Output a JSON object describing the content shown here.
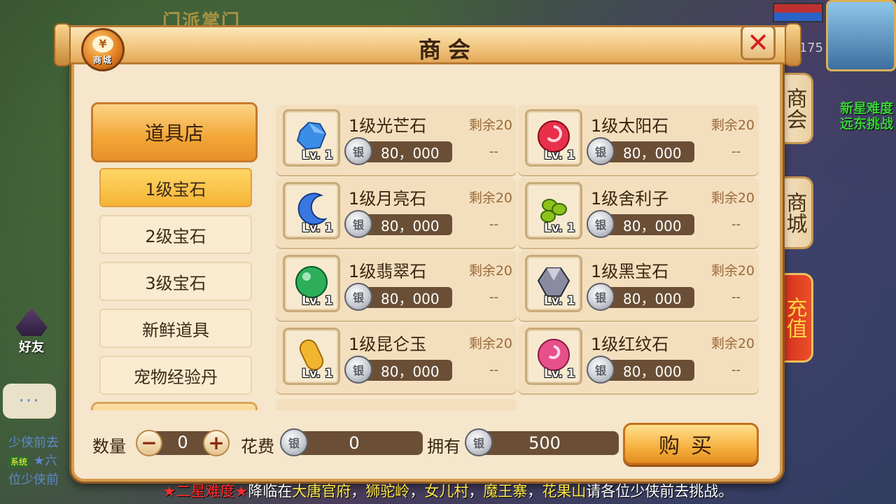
{
  "background": {
    "faded_title": "门派掌门",
    "level": "175",
    "right_notice_lines": [
      "新星难度",
      "远东挑战"
    ],
    "friend_label": "好友",
    "chat_button": "···",
    "chat_lines": [
      {
        "text": "少侠前去"
      },
      {
        "tag": "系统",
        "text": "★六"
      },
      {
        "text": "位少侠前"
      }
    ]
  },
  "window": {
    "title": "商会",
    "shop_icon_symbol": "¥",
    "shop_icon_label": "商城",
    "close_symbol": "✕"
  },
  "side_tabs": [
    {
      "label": "商会"
    },
    {
      "label": "商城"
    },
    {
      "label": "充值"
    }
  ],
  "categories": {
    "main": "道具店",
    "items": [
      {
        "label": "1级宝石",
        "active": true
      },
      {
        "label": "2级宝石",
        "active": false
      },
      {
        "label": "3级宝石",
        "active": false
      },
      {
        "label": "新鲜道具",
        "active": false
      },
      {
        "label": "宠物经验丹",
        "active": false
      }
    ]
  },
  "goods": [
    {
      "name": "1级光芒石",
      "remain": "剩余20",
      "price": "80，000",
      "dash": "--",
      "level": "Lv. 1",
      "gem": "blue-crystal",
      "color": "#3b8ee8"
    },
    {
      "name": "1级太阳石",
      "remain": "剩余20",
      "price": "80，000",
      "dash": "--",
      "level": "Lv. 1",
      "gem": "red-orb",
      "color": "#e8304a"
    },
    {
      "name": "1级月亮石",
      "remain": "剩余20",
      "price": "80，000",
      "dash": "--",
      "level": "Lv. 1",
      "gem": "blue-moon",
      "color": "#3a78e0"
    },
    {
      "name": "1级舍利子",
      "remain": "剩余20",
      "price": "80，000",
      "dash": "--",
      "level": "Lv. 1",
      "gem": "green-beads",
      "color": "#8cc21a"
    },
    {
      "name": "1级翡翠石",
      "remain": "剩余20",
      "price": "80，000",
      "dash": "--",
      "level": "Lv. 1",
      "gem": "green-orb",
      "color": "#2fae5a"
    },
    {
      "name": "1级黑宝石",
      "remain": "剩余20",
      "price": "80，000",
      "dash": "--",
      "level": "Lv. 1",
      "gem": "black-diamond",
      "color": "#8a8aa0"
    },
    {
      "name": "1级昆仑玉",
      "remain": "剩余20",
      "price": "80，000",
      "dash": "--",
      "level": "Lv. 1",
      "gem": "yellow-jade",
      "color": "#f2b530"
    },
    {
      "name": "1级红纹石",
      "remain": "剩余20",
      "price": "80，000",
      "dash": "--",
      "level": "Lv. 1",
      "gem": "pink-swirl",
      "color": "#e8508a"
    }
  ],
  "footer": {
    "qty_label": "数量",
    "qty_value": "0",
    "minus": "−",
    "plus": "+",
    "cost_label": "花费",
    "cost_value": "0",
    "own_label": "拥有",
    "own_value": "500",
    "buy_label": "购买"
  },
  "ticker": {
    "star_prefix": "★二星难度★",
    "t1": "降临在",
    "p1": "大唐官府",
    "sep1": "，",
    "p2": "狮驼岭",
    "sep2": "，",
    "p3": "女儿村",
    "sep3": "，",
    "p4": "魔王寨",
    "sep4": "，",
    "p5": "花果山",
    "t2": "请各位少侠前去挑战。"
  }
}
